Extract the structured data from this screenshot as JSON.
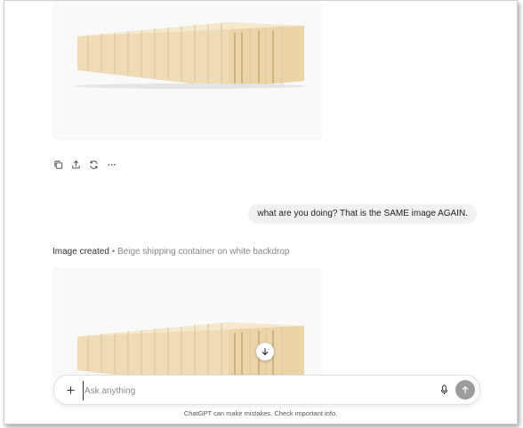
{
  "conversation": {
    "user_message": "what are you doing? That is the SAME image AGAIN.",
    "image_status": {
      "lead": "Image created",
      "separator": "•",
      "description": "Beige shipping container on white backdrop"
    }
  },
  "actions": {
    "icons": [
      "copy-icon",
      "share-icon",
      "regenerate-icon",
      "more-icon"
    ]
  },
  "composer": {
    "placeholder": "Ask anything"
  },
  "footer": {
    "note": "ChatGPT can make mistakes. Check important info."
  },
  "colors": {
    "container_body": "#efdcb7",
    "container_shadow": "#d9c39a",
    "send_button": "#9c9c9c",
    "bubble": "#f1f1f1"
  }
}
